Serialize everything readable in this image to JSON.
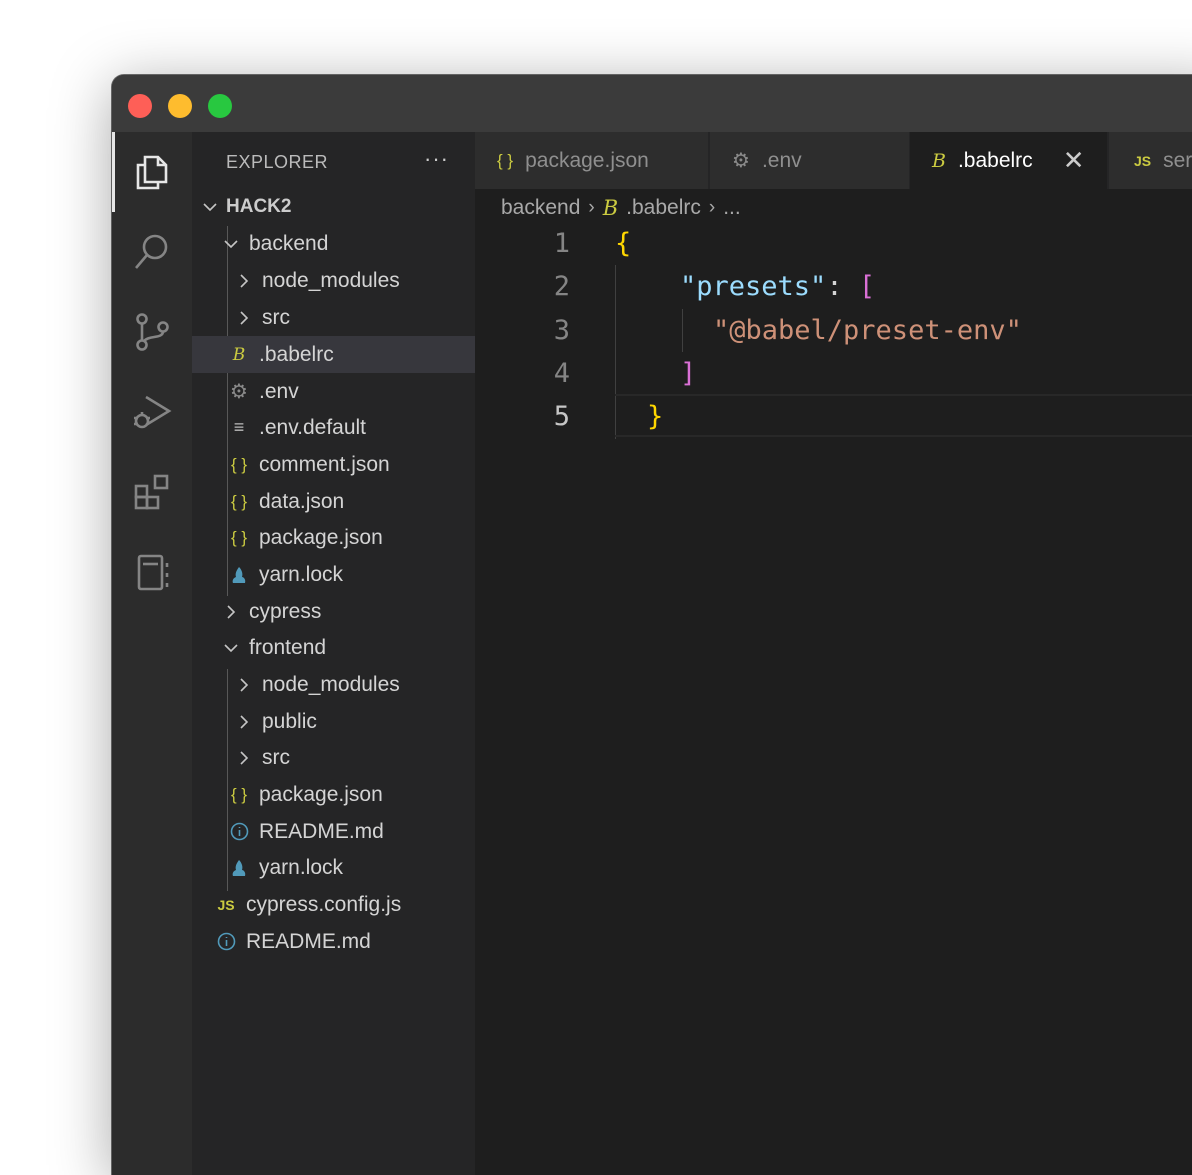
{
  "explorer": {
    "title": "EXPLORER",
    "more": "···",
    "root": "HACK2",
    "items": [
      {
        "label": "backend",
        "kind": "folder-open"
      },
      {
        "label": "node_modules",
        "kind": "folder"
      },
      {
        "label": "src",
        "kind": "folder"
      },
      {
        "label": ".babelrc",
        "kind": "babel",
        "selected": true
      },
      {
        "label": ".env",
        "kind": "gear"
      },
      {
        "label": ".env.default",
        "kind": "lines"
      },
      {
        "label": "comment.json",
        "kind": "json"
      },
      {
        "label": "data.json",
        "kind": "json"
      },
      {
        "label": "package.json",
        "kind": "json"
      },
      {
        "label": "yarn.lock",
        "kind": "yarn"
      },
      {
        "label": "cypress",
        "kind": "folder"
      },
      {
        "label": "frontend",
        "kind": "folder-open"
      },
      {
        "label": "node_modules",
        "kind": "folder"
      },
      {
        "label": "public",
        "kind": "folder"
      },
      {
        "label": "src",
        "kind": "folder"
      },
      {
        "label": "package.json",
        "kind": "json"
      },
      {
        "label": "README.md",
        "kind": "info"
      },
      {
        "label": "yarn.lock",
        "kind": "yarn"
      },
      {
        "label": "cypress.config.js",
        "kind": "js"
      },
      {
        "label": "README.md",
        "kind": "info"
      }
    ]
  },
  "tabs": [
    {
      "label": "package.json",
      "icon": "{ }"
    },
    {
      "label": ".env",
      "icon": "gear"
    },
    {
      "label": ".babelrc",
      "icon": "B",
      "active": true,
      "close": "✕"
    },
    {
      "label": "ser",
      "icon": "JS"
    }
  ],
  "breadcrumb": {
    "folder": "backend",
    "file": ".babelrc",
    "more": "..."
  },
  "code": {
    "line_numbers": [
      "1",
      "2",
      "3",
      "4",
      "5"
    ],
    "open_brace": "{",
    "key": "\"presets\"",
    "colon": ": ",
    "open_bracket": "[",
    "value": "\"@babel/preset-env\"",
    "close_bracket": "]",
    "close_brace": "}"
  },
  "colors": {
    "json_icon": "#cbcb41",
    "babel_icon": "#cbcb41",
    "js_icon": "#cbcb41",
    "gear_icon": "#8a8a8a",
    "info_icon": "#519aba",
    "yarn_icon": "#519aba"
  }
}
